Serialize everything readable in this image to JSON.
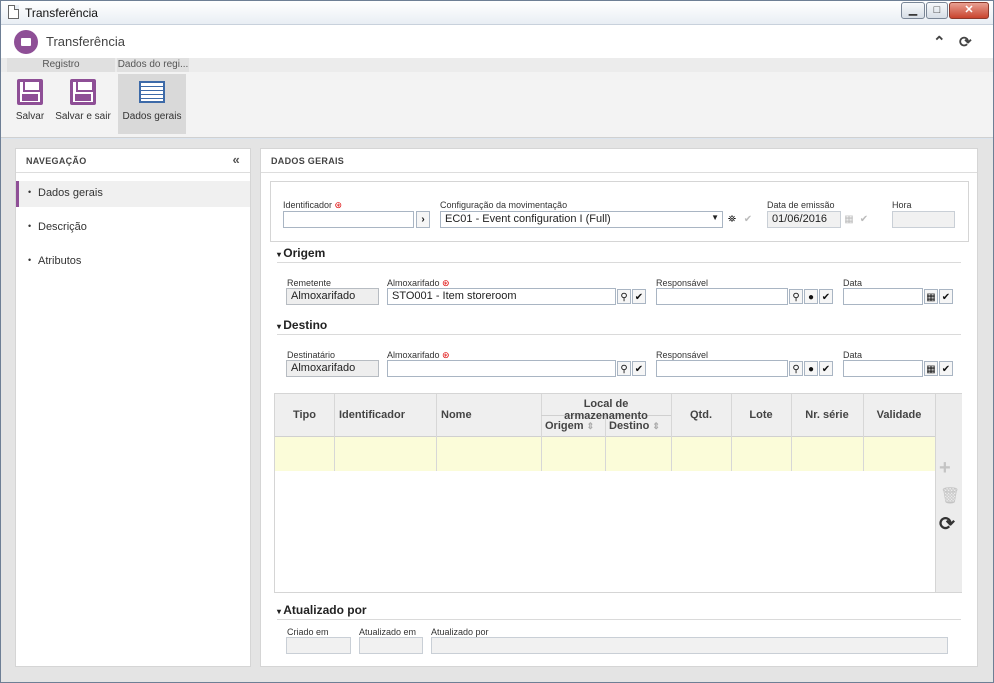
{
  "window": {
    "title": "Transferência",
    "controls": {
      "minimize": "▁",
      "maximize": "□",
      "close": "✕"
    }
  },
  "app": {
    "title": "Transferência",
    "collapse_icon": "double-chevron-up-icon",
    "refresh_icon": "refresh-icon"
  },
  "ribbon": {
    "groups": [
      "Registro",
      "Dados do regi..."
    ],
    "buttons": [
      {
        "label": "Salvar",
        "icon": "save-icon"
      },
      {
        "label": "Salvar e sair",
        "icon": "save-exit-icon"
      },
      {
        "label": "Dados gerais",
        "icon": "form-icon"
      }
    ]
  },
  "nav": {
    "header": "NAVEGAÇÃO",
    "items": [
      "Dados gerais",
      "Descrição",
      "Atributos"
    ],
    "selected": "Dados gerais"
  },
  "content": {
    "header": "DADOS GERAIS",
    "identificador": {
      "label": "Identificador",
      "value": ""
    },
    "config": {
      "label": "Configuração da movimentação",
      "value": "EC01 - Event configuration I (Full)"
    },
    "data_emissao": {
      "label": "Data de emissão",
      "value": "01/06/2016"
    },
    "hora": {
      "label": "Hora",
      "value": ""
    },
    "origem": {
      "title": "Origem",
      "remetente": {
        "label": "Remetente",
        "value": "Almoxarifado"
      },
      "almoxarifado": {
        "label": "Almoxarifado",
        "value": "STO001 - Item storeroom"
      },
      "responsavel": {
        "label": "Responsável",
        "value": ""
      },
      "data": {
        "label": "Data",
        "value": ""
      }
    },
    "destino": {
      "title": "Destino",
      "destinatario": {
        "label": "Destinatário",
        "value": "Almoxarifado"
      },
      "almoxarifado": {
        "label": "Almoxarifado",
        "value": ""
      },
      "responsavel": {
        "label": "Responsável",
        "value": ""
      },
      "data": {
        "label": "Data",
        "value": ""
      }
    },
    "table": {
      "group_header": "Local de armazenamento",
      "columns": [
        "Tipo",
        "Identificador",
        "Nome",
        "Origem",
        "Destino",
        "Qtd.",
        "Lote",
        "Nr. série",
        "Validade"
      ],
      "sort_icon": "⇕",
      "rows": []
    },
    "atualizado": {
      "title": "Atualizado por",
      "criado_em": {
        "label": "Criado em",
        "value": ""
      },
      "atualizado_em": {
        "label": "Atualizado em",
        "value": ""
      },
      "atualizado_por": {
        "label": "Atualizado por",
        "value": ""
      }
    }
  },
  "colors": {
    "accent": "#8e4f96",
    "row_highlight": "#fbfcd9"
  }
}
